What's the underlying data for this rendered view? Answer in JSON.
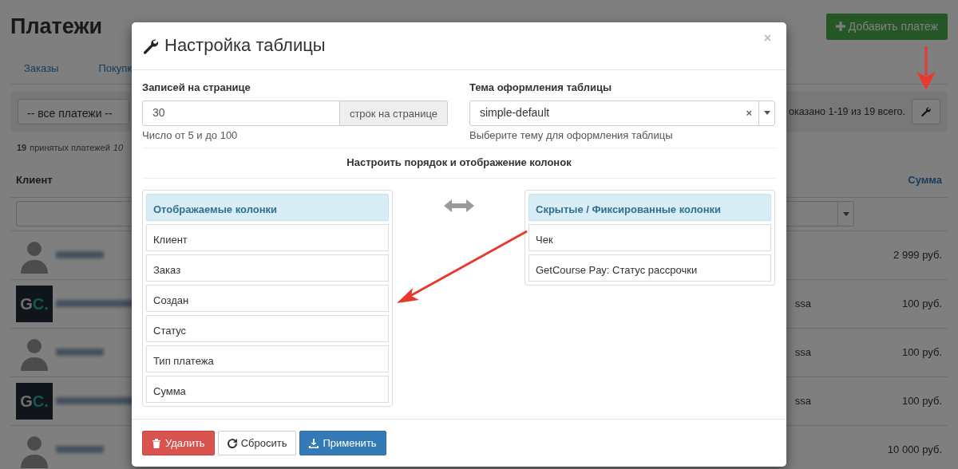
{
  "page": {
    "title": "Платежи",
    "add_button": "Добавить платеж",
    "tabs": [
      {
        "label": "Заказы"
      },
      {
        "label": "Покупк"
      }
    ],
    "filter": {
      "select": "-- все платежи --",
      "summary": "оказано 1-19 из 19 всего."
    },
    "stats": {
      "count": "19",
      "label": "принятых платежей",
      "extra": "10"
    },
    "table": {
      "columns": [
        "Клиент",
        "Сумма"
      ],
      "rows": [
        {
          "kind": "silhouette",
          "amount": "2 999 руб."
        },
        {
          "kind": "logo",
          "logo_text": "GC.",
          "note": "ssa",
          "amount": "100 руб."
        },
        {
          "kind": "silhouette",
          "note": "ssa",
          "amount": "100 руб."
        },
        {
          "kind": "logo",
          "logo_text": "GC.",
          "note": "ssa",
          "amount": "100 руб."
        },
        {
          "kind": "silhouette",
          "amount": "10 000 руб."
        }
      ]
    }
  },
  "modal": {
    "title": "Настройка таблицы",
    "close": "×",
    "per_page": {
      "label": "Записей на странице",
      "value": "30",
      "addon": "строк на странице",
      "help": "Число от 5 и до 100"
    },
    "theme": {
      "label": "Тема оформления таблицы",
      "value": "simple-default",
      "clear": "×",
      "help": "Выберите тему для оформления таблицы"
    },
    "columns_heading": "Настроить порядок и отображение колонок",
    "visible": {
      "title": "Отображаемые колонки",
      "items": [
        "Клиент",
        "Заказ",
        "Создан",
        "Статус",
        "Тип платежа",
        "Сумма"
      ]
    },
    "hidden": {
      "title": "Скрытые / Фиксированные колонки",
      "items": [
        "Чек",
        "GetCourse Pay: Статус рассрочки"
      ]
    },
    "buttons": [
      {
        "kind": "danger",
        "label": "Удалить"
      },
      {
        "kind": "reset",
        "label": "Сбросить"
      },
      {
        "kind": "apply",
        "label": "Применить"
      }
    ]
  }
}
